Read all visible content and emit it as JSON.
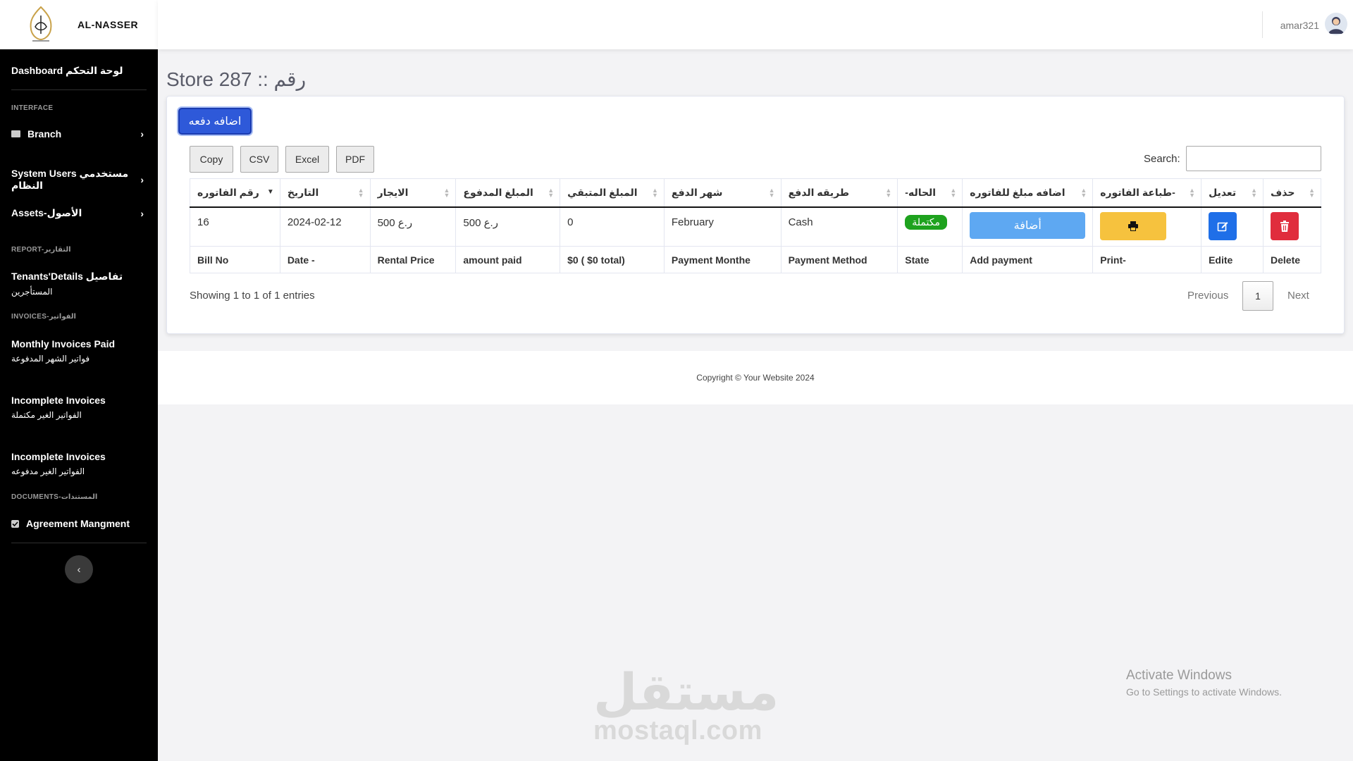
{
  "brand": {
    "name": "AL-NASSER"
  },
  "sidebar": {
    "dashboard": "Dashboard لوحة التحكم",
    "interface_heading": "INTERFACE",
    "branch": "Branch",
    "system_users": "System Users مستخدمي النظام",
    "assets": "Assets-الأصول",
    "report_heading": "REPORT-التقارير",
    "tenants_details_1": "Tenants'Details تفاصيل",
    "tenants_details_2": "المستأجرين",
    "invoices_heading": "INVOICES-الفواتير",
    "monthly_paid_1": "Monthly Invoices Paid",
    "monthly_paid_2": "فواتير الشهر المدفوعة",
    "incomplete_1": "Incomplete Invoices",
    "incomplete_1_sub": "الفواتير الغير مكتملة",
    "incomplete_2": "Incomplete Invoices",
    "incomplete_2_sub": "الفواتير الغير مدفوعه",
    "documents_heading": "DOCUMENTS-المستندات",
    "agreement": "Agreement Mangment",
    "chevron_right": "›",
    "collapse_icon": "‹"
  },
  "topbar": {
    "username": "amar321"
  },
  "page": {
    "title": "Store 287 :: رقم"
  },
  "toolbar": {
    "add_label": "اضافه دفعه",
    "copy": "Copy",
    "csv": "CSV",
    "excel": "Excel",
    "pdf": "PDF",
    "search_label": "Search:"
  },
  "table": {
    "headers": [
      "رقم الفاتوره",
      "التاريخ",
      "الايجار",
      "المبلغ المدفوع",
      "المبلغ المتبقي",
      "شهر الدفع",
      "طريقه الدفع",
      "-الحاله",
      "اضافه مبلغ للفاتوره",
      "طباعة الفاتوره-",
      "تعديل",
      "حذف"
    ],
    "row": {
      "bill_no": "16",
      "date": "2024-02-12",
      "rental_price": "ر.ع 500",
      "amount_paid": "ر.ع 500",
      "remaining": "0",
      "payment_month": "February",
      "payment_method": "Cash",
      "state": "مكتملة",
      "add_payment": "أضافة"
    },
    "footers": [
      "Bill No",
      "Date -",
      "Rental Price",
      "amount paid",
      "$0 ( $0 total)",
      "Payment Monthe",
      "Payment Method",
      "State",
      "Add payment",
      "Print-",
      "Edite",
      "Delete"
    ]
  },
  "pagination": {
    "info": "Showing 1 to 1 of 1 entries",
    "previous": "Previous",
    "current": "1",
    "next": "Next"
  },
  "footer": {
    "copyright": "Copyright © Your Website 2024"
  },
  "watermark": {
    "arabic": "مستقل",
    "latin": "mostaql.com"
  },
  "windows": {
    "line1": "Activate Windows",
    "line2": "Go to Settings to activate Windows."
  },
  "colors": {
    "primary": "#2e59d9",
    "success": "#1ea21e",
    "warning": "#f6c23e",
    "danger": "#e02d3d",
    "info": "#5ea8f2"
  }
}
